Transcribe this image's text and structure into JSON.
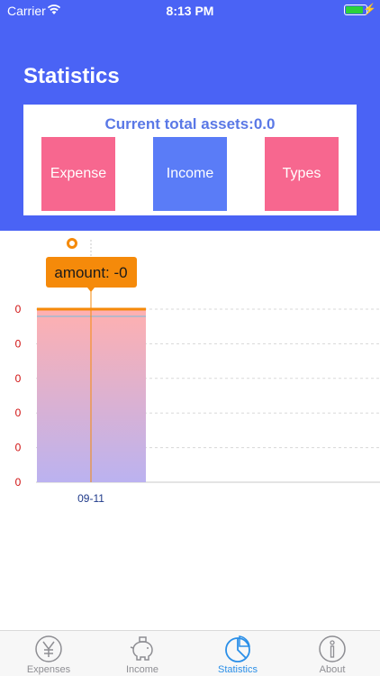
{
  "status_bar": {
    "carrier": "Carrier",
    "time": "8:13 PM"
  },
  "header": {
    "title": "Statistics",
    "current_assets": "Current total assets:0.0"
  },
  "tiles": [
    {
      "label": "Expense",
      "color": "#f7678f"
    },
    {
      "label": "Income",
      "color": "#5a7cf7"
    },
    {
      "label": "Types",
      "color": "#f7678f"
    }
  ],
  "chart_data": {
    "type": "bar",
    "categories": [
      "09-11"
    ],
    "values": [
      0
    ],
    "y_tick_labels": [
      "0",
      "0",
      "0",
      "0",
      "0",
      "0"
    ],
    "tooltip": "amount: -0",
    "grid": true
  },
  "tabbar": {
    "tabs": [
      {
        "label": "Expenses",
        "icon": "yen-icon",
        "active": false
      },
      {
        "label": "Income",
        "icon": "piggy-bank-icon",
        "active": false
      },
      {
        "label": "Statistics",
        "icon": "pie-chart-icon",
        "active": true
      },
      {
        "label": "About",
        "icon": "info-icon",
        "active": false
      }
    ]
  },
  "colors": {
    "header": "#4a63f5",
    "accent": "#5a78e6",
    "tooltip": "#f58a0a",
    "active_tab": "#2b8fe8"
  }
}
